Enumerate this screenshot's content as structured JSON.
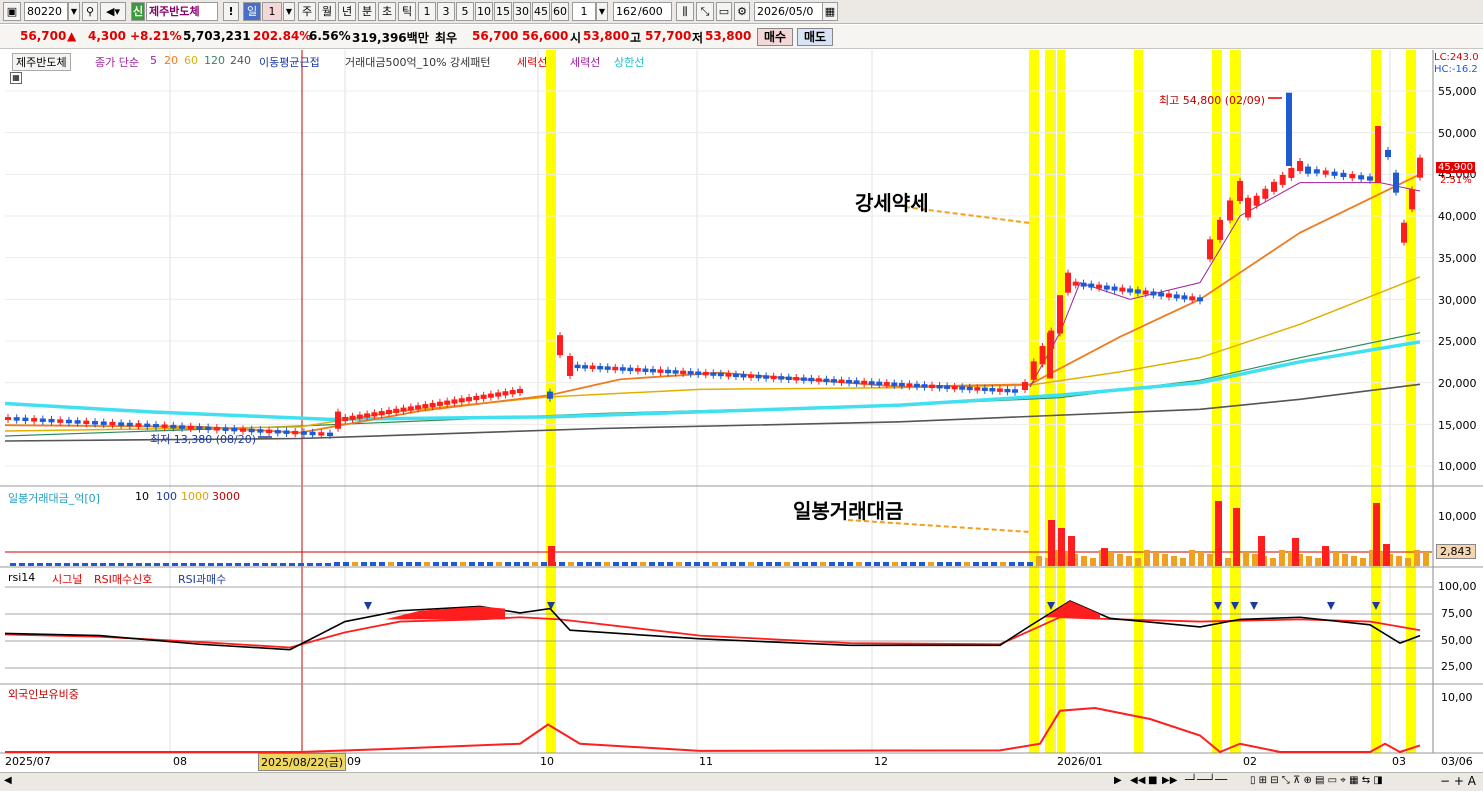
{
  "toolbar": {
    "code": "80220",
    "stock_name": "제주반도체",
    "period_buttons": [
      "일",
      "1",
      "주",
      "월",
      "년",
      "분",
      "초",
      "틱",
      "1",
      "3",
      "5",
      "10",
      "15",
      "30",
      "45",
      "60",
      "1"
    ],
    "count": "162",
    "count_total": "/600",
    "date": "2026/05/0"
  },
  "quote": {
    "price": "56,700",
    "change_arrow": "▲",
    "change": "4,300",
    "change_pct": "+8.21%",
    "volume": "5,703,231",
    "volume_ratio": "202.84%",
    "turnover": "6.56%",
    "amount": "319,396백만",
    "best_label": "최우",
    "best_ask": "56,700",
    "best_bid": "56,600",
    "open_label": "시",
    "open": "53,800",
    "high_label": "고",
    "high": "57,700",
    "low_label": "저",
    "low": "53,800",
    "buy_label": "매수",
    "sell_label": "매도"
  },
  "legend": {
    "name": "제주반도체",
    "ma_label": "종가 단순",
    "ma_periods": [
      "5",
      "20",
      "60",
      "120",
      "240"
    ],
    "ma_group": "이동평균근접",
    "pattern": "거래대금500억_10% 강세패턴",
    "line1": "세력선",
    "line2": "세력선",
    "line3": "상한선",
    "lc": "LC:243.0",
    "hc": "HC:-16.2"
  },
  "annotations": {
    "high": "최고 54,800 (02/09)",
    "low": "최저 13,380 (08/20)",
    "strong_weak": "강세약세",
    "daily_amount": "일봉거래대금"
  },
  "price_axis": [
    "55,000",
    "50,000",
    "45,000",
    "40,000",
    "35,000",
    "30,000",
    "25,000",
    "20,000",
    "15,000",
    "10,000"
  ],
  "price_tag": "45,900",
  "price_tag_pct": "2.51%",
  "volume_panel": {
    "title": "일봉거래대금_억[0]",
    "levels": [
      "10",
      "100",
      "1000",
      "3000"
    ],
    "axis": [
      "10,000"
    ],
    "value_tag": "2,843"
  },
  "rsi_panel": {
    "title": "rsi14",
    "signal": "시그널",
    "buy_signal": "RSI매수신호",
    "overbuy": "RSI과매수",
    "axis": [
      "100,00",
      "75,00",
      "50,00",
      "25,00"
    ]
  },
  "foreign_panel": {
    "title": "외국인보유비중",
    "axis": [
      "10,00"
    ]
  },
  "time_axis": {
    "labels": [
      "2025/07",
      "08",
      "09",
      "10",
      "11",
      "12",
      "2026/01",
      "02",
      "03",
      "03/06"
    ],
    "cursor_date": "2025/08/22(금)"
  },
  "colors": {
    "up": "#ff1e1e",
    "down": "#1e5ad2",
    "highlight": "#ffff00",
    "ma5": "#a020a0",
    "ma20": "#f07a1e",
    "ma60": "#e0b000",
    "ma120": "#2e8b57",
    "ma240": "#555555",
    "ma_cyan": "#40e0f0"
  }
}
